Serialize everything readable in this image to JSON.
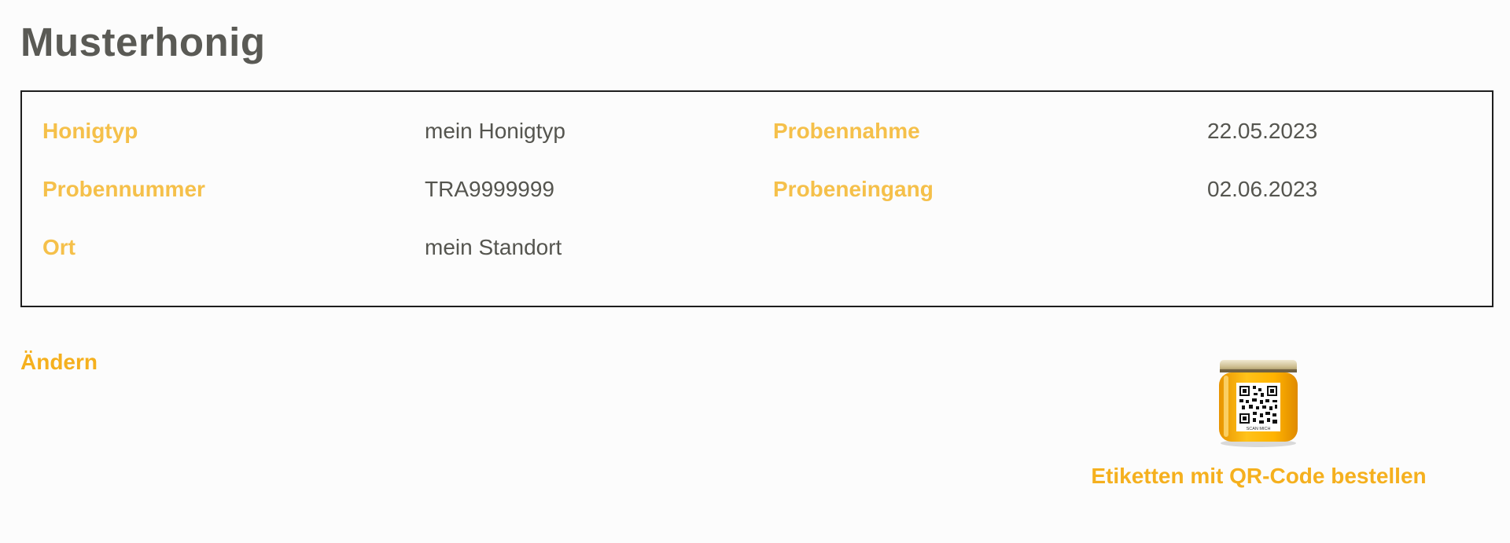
{
  "page": {
    "title": "Musterhonig"
  },
  "details": {
    "honigtyp_label": "Honigtyp",
    "honigtyp_value": "mein Honigtyp",
    "probennummer_label": "Probennummer",
    "probennummer_value": "TRA9999999",
    "ort_label": "Ort",
    "ort_value": "mein Standort",
    "probennahme_label": "Probennahme",
    "probennahme_value": "22.05.2023",
    "probeneingang_label": "Probeneingang",
    "probeneingang_value": "02.06.2023"
  },
  "actions": {
    "edit_label": "Ändern",
    "order_labels_label": "Etiketten mit QR-Code bestellen"
  },
  "promo": {
    "jar_icon": "honey-jar-qr-image",
    "jar_label": "SCAN MICH"
  },
  "colors": {
    "label": "#f5c04a",
    "link": "#f5b01e",
    "text": "#55554f",
    "title": "#5a5a55",
    "border": "#1e1e1e"
  }
}
